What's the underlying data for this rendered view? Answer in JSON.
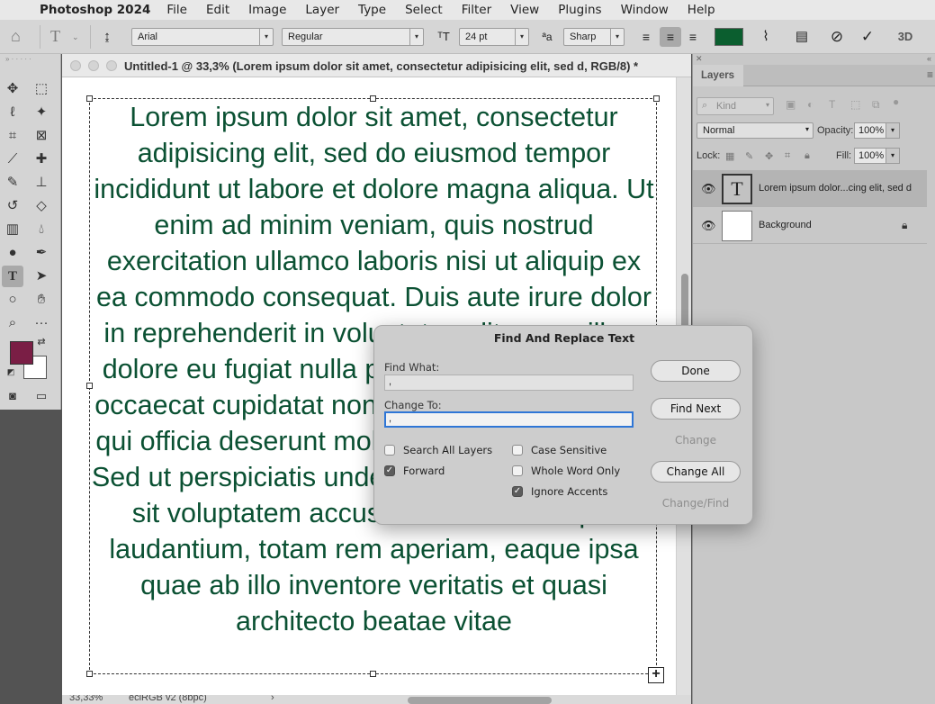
{
  "menubar": {
    "app_name": "Photoshop 2024",
    "items": [
      "File",
      "Edit",
      "Image",
      "Layer",
      "Type",
      "Select",
      "Filter",
      "View",
      "Plugins",
      "Window",
      "Help"
    ]
  },
  "options_bar": {
    "font_family": "Arial",
    "font_style": "Regular",
    "font_size": "24 pt",
    "antialias": "Sharp",
    "text_color": "#0b5e2f",
    "threed_label": "3D",
    "aa_glyph": "ªa"
  },
  "document": {
    "title": "Untitled-1 @ 33,3% (Lorem ipsum dolor sit amet, consectetur adipisicing elit, sed d, RGB/8) *",
    "text_color": "#0b5133",
    "text": "Lorem ipsum dolor sit amet, consectetur adipisicing elit, sed do eiusmod tempor incididunt ut labore et dolore magna aliqua. Ut enim ad minim veniam, quis nostrud exercitation ullamco laboris nisi ut aliquip ex ea commodo consequat. Duis aute irure dolor in reprehenderit in voluptate velit esse cillum dolore eu fugiat nulla pariatur. Excepteur sint occaecat cupidatat non proident, sunt in culpa qui officia deserunt mollit anim id est laborum. Sed ut perspiciatis unde omnis iste natus error sit voluptatem accusantium doloremque laudantium, totam rem aperiam, eaque ipsa quae ab illo inventore veritatis et quasi architecto beatae vitae",
    "zoom": "33,33%",
    "profile": "eciRGB v2 (8bpc)"
  },
  "tools": {
    "foreground_color": "#7a1e45",
    "background_color": "#ffffff"
  },
  "layers_panel": {
    "tab_label": "Layers",
    "kind_placeholder": "Kind",
    "blend_mode": "Normal",
    "opacity_label": "Opacity:",
    "opacity_value": "100%",
    "lock_label": "Lock:",
    "fill_label": "Fill:",
    "fill_value": "100%",
    "layers": [
      {
        "name": "Lorem ipsum dolor...cing elit, sed d",
        "type": "text",
        "selected": true
      },
      {
        "name": "Background",
        "type": "background",
        "selected": false
      }
    ]
  },
  "dialog": {
    "title": "Find And Replace Text",
    "find_label": "Find What:",
    "find_value": ",",
    "change_label": "Change To:",
    "change_value": ",",
    "options": {
      "search_all_layers": {
        "label": "Search All Layers",
        "checked": false
      },
      "forward": {
        "label": "Forward",
        "checked": true
      },
      "case_sensitive": {
        "label": "Case Sensitive",
        "checked": false
      },
      "whole_word_only": {
        "label": "Whole Word Only",
        "checked": false
      },
      "ignore_accents": {
        "label": "Ignore Accents",
        "checked": true
      }
    },
    "buttons": {
      "done": "Done",
      "find_next": "Find Next",
      "change": "Change",
      "change_all": "Change All",
      "change_find": "Change/Find"
    }
  }
}
